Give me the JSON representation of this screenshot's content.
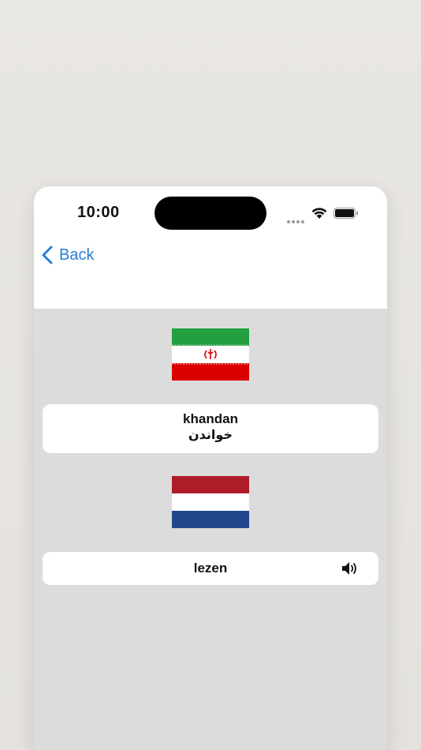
{
  "status_bar": {
    "time": "10:00"
  },
  "nav": {
    "back_label": "Back"
  },
  "source": {
    "flag": "iran-flag",
    "transliteration": "khandan",
    "native": "خواندن"
  },
  "target": {
    "flag": "netherlands-flag",
    "word": "lezen",
    "audio_icon": "speaker-icon"
  },
  "colors": {
    "accent": "#2a7fd4",
    "background": "#dcdcdc",
    "card": "#ffffff",
    "iran_green": "#239f40",
    "iran_red": "#da0000",
    "nl_red": "#ae1c28",
    "nl_blue": "#21468b"
  }
}
